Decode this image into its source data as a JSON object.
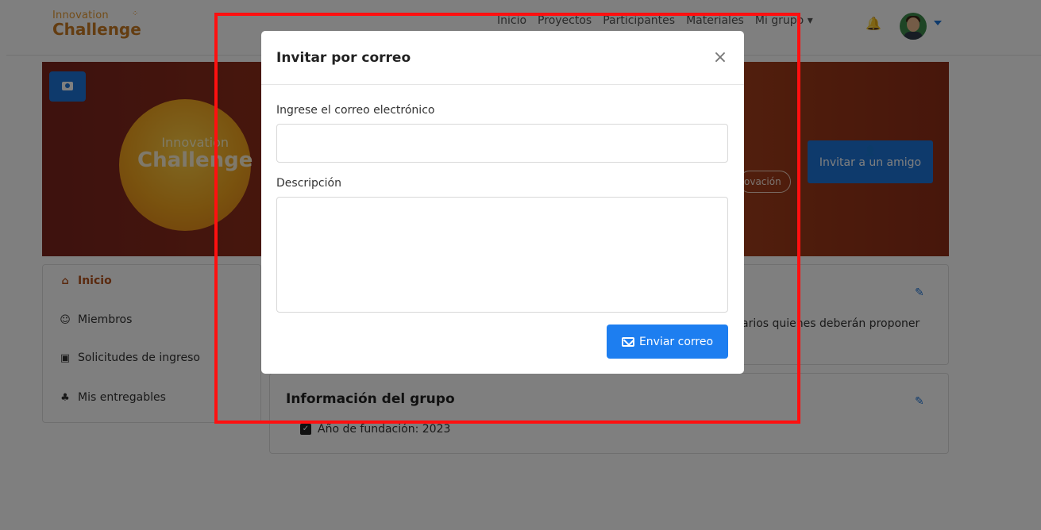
{
  "navbar": {
    "logo_line1": "Innovation",
    "logo_line2": "Challenge",
    "links": [
      "Inicio",
      "Proyectos",
      "Participantes",
      "Materiales",
      "Mi grupo ▾"
    ]
  },
  "banner": {
    "logo_line1": "Innovation",
    "logo_line2": "Challenge",
    "pill_text": "ovación",
    "invite_friend_label": "Invitar a un amigo"
  },
  "sidebar": {
    "items": [
      {
        "label": "Inicio",
        "icon": "home-icon"
      },
      {
        "label": "Miembros",
        "icon": "users-icon"
      },
      {
        "label": "Solicitudes de ingreso",
        "icon": "rss-icon"
      },
      {
        "label": "Mis entregables",
        "icon": "group-icon"
      }
    ]
  },
  "cards": {
    "card1_partial_text": "arios quienes deberán proponer",
    "card2_title": "Información del grupo",
    "card2_item": "Año de fundación: 2023"
  },
  "modal": {
    "title": "Invitar por correo",
    "close_symbol": "×",
    "email_label": "Ingrese el correo electrónico",
    "email_value": "",
    "description_label": "Descripción",
    "description_value": "",
    "send_label": "Enviar correo"
  },
  "colors": {
    "primary": "#1d74d8",
    "highlight": "#ff1010",
    "accent": "#b4521d"
  }
}
